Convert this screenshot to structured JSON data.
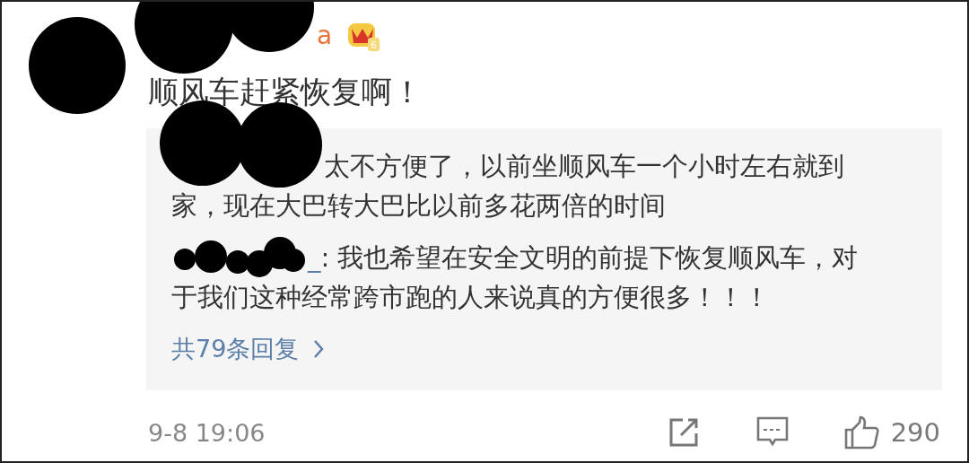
{
  "comment": {
    "author_tail": "a",
    "badge_level": "6",
    "text": "顺风车赶紧恢复啊！"
  },
  "replies": [
    {
      "lines": [
        "太不方便了，以前坐顺风车一个小时左右就到",
        "家，现在大巴转大巴比以前多花两倍的时间"
      ]
    },
    {
      "author": "_",
      "lines": [
        ": 我也希望在安全文明的前提下恢复顺风车，对",
        "于我们这种经常跨市跑的人来说真的方便很多！！！"
      ]
    }
  ],
  "more_replies": "共79条回复",
  "footer": {
    "time": "9-8 19:06",
    "likes": "290"
  }
}
